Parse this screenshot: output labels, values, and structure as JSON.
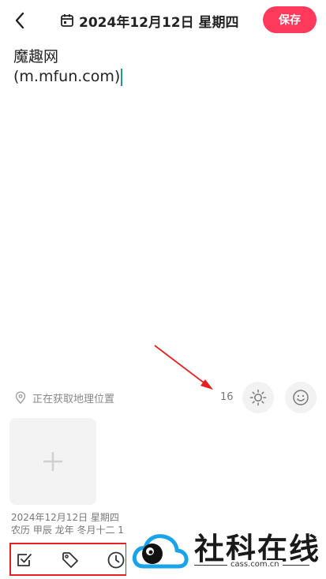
{
  "header": {
    "date_title": "2024年12月12日 星期四",
    "save_label": "保存"
  },
  "editor": {
    "line1": "魔趣网",
    "line2": "(m.mfun.com)"
  },
  "meta_row": {
    "location_text": "正在获取地理位置",
    "count": "16"
  },
  "attachment": {
    "date_line": "2024年12月12日 星期四",
    "lunar_line": "农历 甲辰 龙年 冬月十二 1"
  },
  "watermark": {
    "text": "社科在线",
    "url": "cass.com.cn"
  },
  "colors": {
    "accent": "#ff3a5c",
    "highlight_border": "#e52020",
    "arrow": "#e52020",
    "logo_blue": "#1aa3e8"
  },
  "icons": {
    "back": "chevron-left-icon",
    "calendar": "calendar-icon",
    "location": "location-pin-icon",
    "weather": "sun-icon",
    "mood": "smiley-icon",
    "add": "plus-icon",
    "todo": "checkbox-icon",
    "tag": "tag-icon",
    "time": "clock-icon"
  }
}
